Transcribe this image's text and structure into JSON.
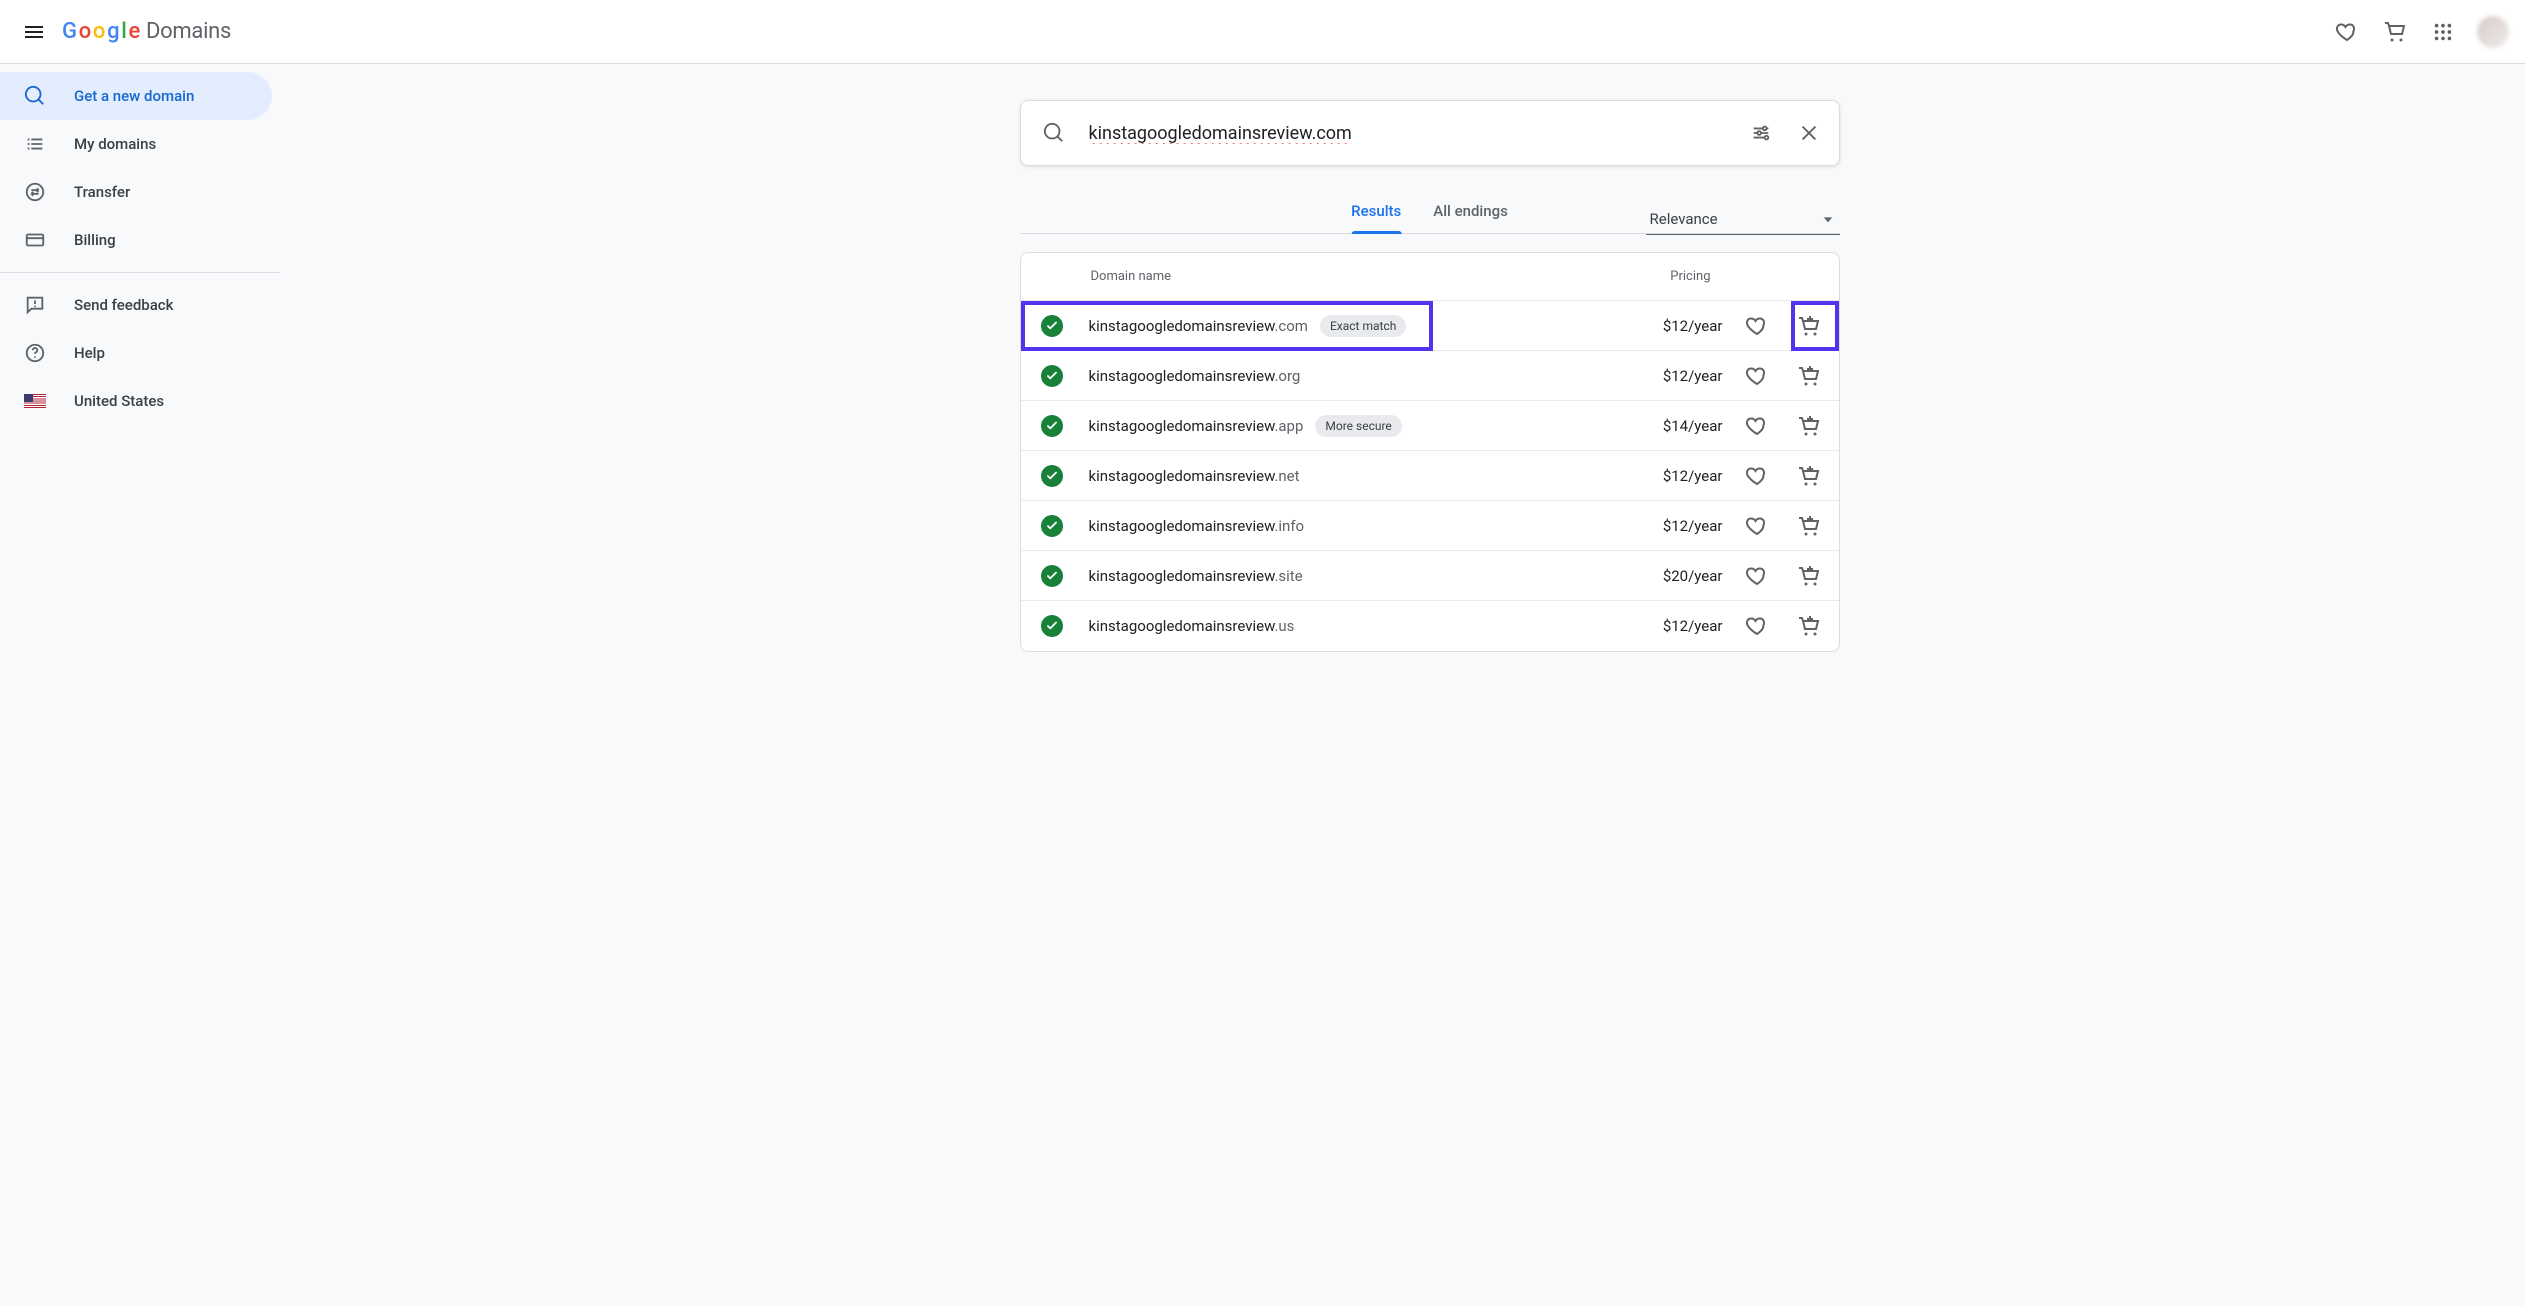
{
  "header": {
    "product": "Domains"
  },
  "sidebar": {
    "items": [
      {
        "label": "Get a new domain"
      },
      {
        "label": "My domains"
      },
      {
        "label": "Transfer"
      },
      {
        "label": "Billing"
      },
      {
        "label": "Send feedback"
      },
      {
        "label": "Help"
      },
      {
        "label": "United States"
      }
    ]
  },
  "search": {
    "value": "kinstagoogledomainsreview.com"
  },
  "tabs": {
    "results": "Results",
    "all_endings": "All endings"
  },
  "sort": {
    "label": "Relevance"
  },
  "table": {
    "col_name": "Domain name",
    "col_price": "Pricing"
  },
  "pills": {
    "exact_match": "Exact match",
    "more_secure": "More secure"
  },
  "results": [
    {
      "name": "kinstagoogledomainsreview",
      "tld": ".com",
      "price": "$12/year"
    },
    {
      "name": "kinstagoogledomainsreview",
      "tld": ".org",
      "price": "$12/year"
    },
    {
      "name": "kinstagoogledomainsreview",
      "tld": ".app",
      "price": "$14/year"
    },
    {
      "name": "kinstagoogledomainsreview",
      "tld": ".net",
      "price": "$12/year"
    },
    {
      "name": "kinstagoogledomainsreview",
      "tld": ".info",
      "price": "$12/year"
    },
    {
      "name": "kinstagoogledomainsreview",
      "tld": ".site",
      "price": "$20/year"
    },
    {
      "name": "kinstagoogledomainsreview",
      "tld": ".us",
      "price": "$12/year"
    }
  ]
}
